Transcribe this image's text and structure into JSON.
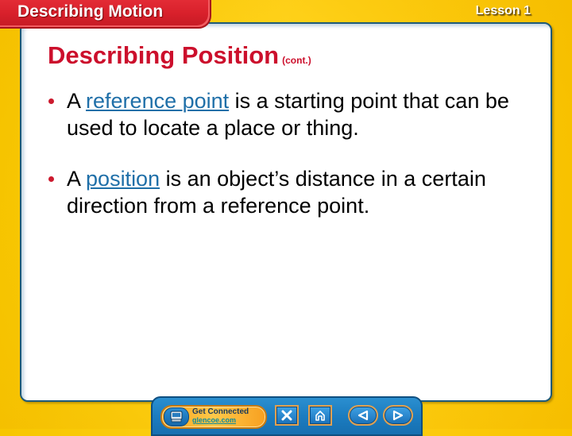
{
  "header": {
    "section_title": "Describing Motion",
    "lesson_label": "Lesson 1"
  },
  "slide": {
    "title": "Describing Position",
    "title_suffix": "(cont.)",
    "bullets": [
      {
        "prefix": "A ",
        "keyword": "reference point",
        "suffix": " is a starting point that can be used to locate a place or thing."
      },
      {
        "prefix": "A ",
        "keyword": "position",
        "suffix": " is an object’s distance in a certain direction from a reference point."
      }
    ]
  },
  "nav": {
    "get_connected_label": "Get Connected",
    "get_connected_link": "glencoe.com",
    "buttons": [
      {
        "name": "exit",
        "icon": "close-icon"
      },
      {
        "name": "home",
        "icon": "home-icon"
      },
      {
        "name": "previous",
        "icon": "triangle-left-icon"
      },
      {
        "name": "next",
        "icon": "triangle-right-icon"
      }
    ]
  },
  "colors": {
    "frame": "#ffd21a",
    "tab_red": "#d8202b",
    "title_red": "#cc0f2c",
    "keyword_blue": "#1f6fa8",
    "panel_border": "#1e5a78",
    "nav_blue": "#1b7cc0"
  }
}
